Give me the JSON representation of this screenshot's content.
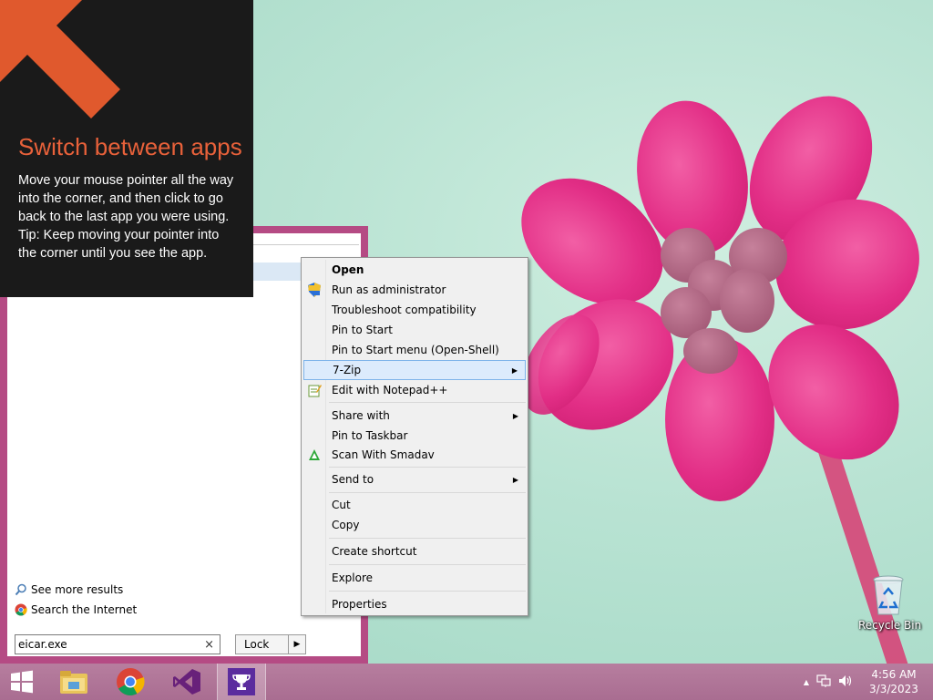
{
  "hint": {
    "title": "Switch between apps",
    "body_line1": "Move your mouse pointer all the way into the corner, and then click to go back to the last app you were using.",
    "body_line2": "Tip: Keep moving your pointer into the corner until you see the app."
  },
  "start_menu": {
    "see_more": "See more results",
    "search_internet": "Search the Internet",
    "search_value": "eicar.exe",
    "clear_glyph": "×",
    "lock_label": "Lock",
    "lock_arrow": "▶"
  },
  "context_menu": {
    "items": [
      {
        "label": "Open",
        "bold": true
      },
      {
        "label": "Run as administrator",
        "icon": "uac-shield-icon"
      },
      {
        "label": "Troubleshoot compatibility"
      },
      {
        "label": "Pin to Start"
      },
      {
        "label": "Pin to Start menu (Open-Shell)"
      },
      {
        "label": "7-Zip",
        "submenu": true,
        "highlighted": true
      },
      {
        "label": "Edit with Notepad++",
        "icon": "notepadpp-icon"
      },
      {
        "label": "Share with",
        "submenu": true
      },
      {
        "label": "Pin to Taskbar"
      },
      {
        "label": "Scan With Smadav",
        "icon": "smadav-icon"
      },
      {
        "label": "Send to",
        "submenu": true
      },
      {
        "label": "Cut"
      },
      {
        "label": "Copy"
      },
      {
        "label": "Create shortcut"
      },
      {
        "label": "Explore"
      },
      {
        "label": "Properties"
      }
    ],
    "submenu_glyph": "▶"
  },
  "desktop": {
    "recycle_bin": "Recycle Bin"
  },
  "taskbar": {
    "apps": [
      "windows-start-icon",
      "file-explorer-icon",
      "chrome-icon",
      "visual-studio-icon",
      "trophy-app-icon"
    ],
    "tray_up_glyph": "▲",
    "time": "4:56 AM",
    "date": "3/3/2023"
  },
  "colors": {
    "hint_title": "#e8613a",
    "start_border": "#b54b84",
    "taskbar": "#b77e9f",
    "menu_highlight": "#dcebfc"
  }
}
